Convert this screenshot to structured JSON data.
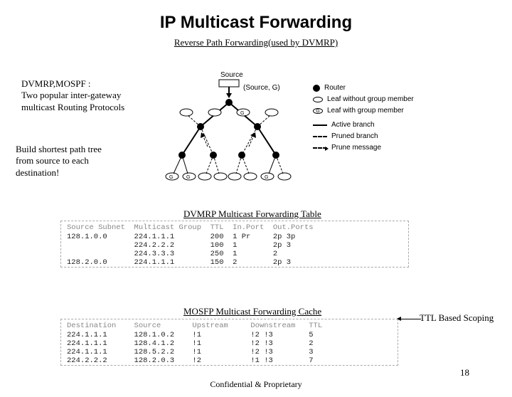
{
  "title": "IP Multicast Forwarding",
  "subtitle": "Reverse Path Forwarding(used by DVMRP)",
  "note1_line1": "DVMRP,MOSPF :",
  "note1_line2": "Two popular inter-gateway",
  "note1_line3": "multicast Routing Protocols",
  "note2_line1": "Build shortest path tree",
  "note2_line2": "from source to each",
  "note2_line3": "destination!",
  "diagram": {
    "source_label": "Source",
    "source_group": "(Source, G)",
    "g_label": "G"
  },
  "legend": {
    "router": "Router",
    "leaf_no_member": "Leaf without group member",
    "leaf_member": "Leaf with group member",
    "active": "Active branch",
    "pruned": "Pruned branch",
    "prune_msg": "Prune message"
  },
  "table1": {
    "caption": "DVMRP Multicast Forwarding Table",
    "headers": "Source Subnet  Multicast Group  TTL  In.Port  Out.Ports",
    "rows": [
      "128.1.0.0      224.1.1.1        200  1 Pr     2p 3p",
      "               224.2.2.2        100  1        2p 3",
      "               224.3.3.3        250  1        2",
      "128.2.0.0      224.1.1.1        150  2        2p 3"
    ]
  },
  "table2": {
    "caption": "MOSFP Multicast Forwarding Cache",
    "headers": "Destination    Source       Upstream     Downstream   TTL",
    "rows": [
      "224.1.1.1      128.1.0.2    !1           !2 !3        5",
      "224.1.1.1      128.4.1.2    !1           !2 !3        2",
      "224.1.1.1      128.5.2.2    !1           !2 !3        3",
      "224.2.2.2      128.2.0.3    !2           !1 !3        7"
    ]
  },
  "scope_label": "TTL Based Scoping",
  "page_number": "18",
  "footer": "Confidential & Proprietary"
}
